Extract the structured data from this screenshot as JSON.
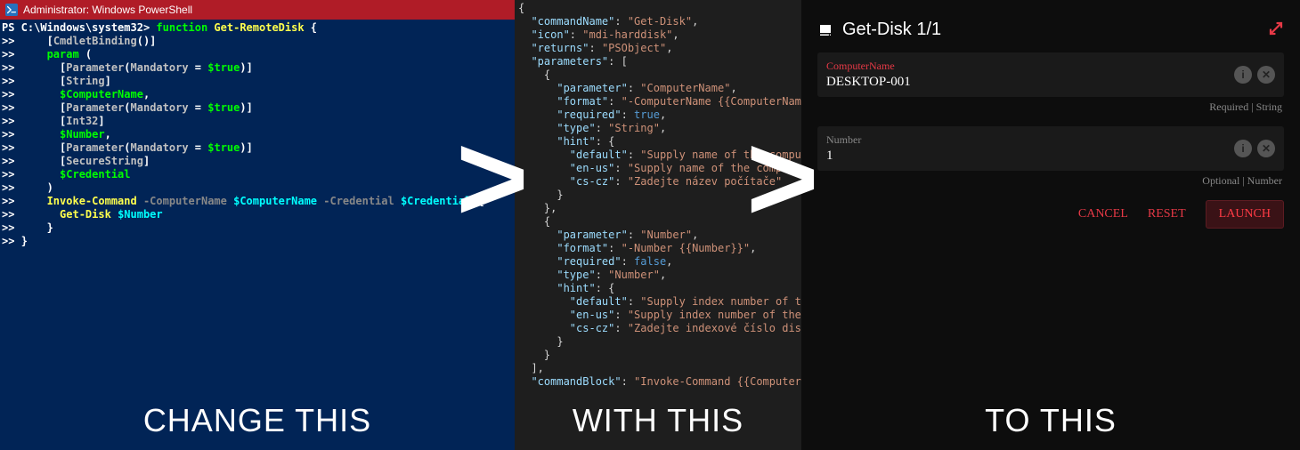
{
  "arrows": {
    "a1": ">",
    "a2": ">"
  },
  "captions": {
    "ps": "CHANGE THIS",
    "json": "WITH THIS",
    "ui": "TO THIS"
  },
  "ps": {
    "title": "Administrator: Windows PowerShell",
    "code": [
      {
        "segs": [
          {
            "t": "PS C:\\Windows\\system32> ",
            "c": "c-white"
          },
          {
            "t": "function",
            "c": "c-key"
          },
          {
            "t": " ",
            "c": "c-white"
          },
          {
            "t": "Get-RemoteDisk",
            "c": "c-cmd"
          },
          {
            "t": " {",
            "c": "c-white"
          }
        ]
      },
      {
        "segs": [
          {
            "t": ">>     ",
            "c": "c-white"
          },
          {
            "t": "[",
            "c": "c-white"
          },
          {
            "t": "CmdletBinding",
            "c": "c-type"
          },
          {
            "t": "()]",
            "c": "c-white"
          }
        ]
      },
      {
        "segs": [
          {
            "t": ">>     ",
            "c": "c-white"
          },
          {
            "t": "param",
            "c": "c-key"
          },
          {
            "t": " (",
            "c": "c-white"
          }
        ]
      },
      {
        "segs": [
          {
            "t": ">>       ",
            "c": "c-white"
          },
          {
            "t": "[",
            "c": "c-white"
          },
          {
            "t": "Parameter",
            "c": "c-type"
          },
          {
            "t": "(",
            "c": "c-white"
          },
          {
            "t": "Mandatory",
            "c": "c-type"
          },
          {
            "t": " = ",
            "c": "c-white"
          },
          {
            "t": "$true",
            "c": "c-key"
          },
          {
            "t": ")]",
            "c": "c-white"
          }
        ]
      },
      {
        "segs": [
          {
            "t": ">>       ",
            "c": "c-white"
          },
          {
            "t": "[",
            "c": "c-white"
          },
          {
            "t": "String",
            "c": "c-type"
          },
          {
            "t": "]",
            "c": "c-white"
          }
        ]
      },
      {
        "segs": [
          {
            "t": ">>       ",
            "c": "c-white"
          },
          {
            "t": "$ComputerName",
            "c": "c-key"
          },
          {
            "t": ",",
            "c": "c-white"
          }
        ]
      },
      {
        "segs": [
          {
            "t": ">>       ",
            "c": "c-white"
          },
          {
            "t": "[",
            "c": "c-white"
          },
          {
            "t": "Parameter",
            "c": "c-type"
          },
          {
            "t": "(",
            "c": "c-white"
          },
          {
            "t": "Mandatory",
            "c": "c-type"
          },
          {
            "t": " = ",
            "c": "c-white"
          },
          {
            "t": "$true",
            "c": "c-key"
          },
          {
            "t": ")]",
            "c": "c-white"
          }
        ]
      },
      {
        "segs": [
          {
            "t": ">>       ",
            "c": "c-white"
          },
          {
            "t": "[",
            "c": "c-white"
          },
          {
            "t": "Int32",
            "c": "c-type"
          },
          {
            "t": "]",
            "c": "c-white"
          }
        ]
      },
      {
        "segs": [
          {
            "t": ">>       ",
            "c": "c-white"
          },
          {
            "t": "$Number",
            "c": "c-key"
          },
          {
            "t": ",",
            "c": "c-white"
          }
        ]
      },
      {
        "segs": [
          {
            "t": ">>       ",
            "c": "c-white"
          },
          {
            "t": "[",
            "c": "c-white"
          },
          {
            "t": "Parameter",
            "c": "c-type"
          },
          {
            "t": "(",
            "c": "c-white"
          },
          {
            "t": "Mandatory",
            "c": "c-type"
          },
          {
            "t": " = ",
            "c": "c-white"
          },
          {
            "t": "$true",
            "c": "c-key"
          },
          {
            "t": ")]",
            "c": "c-white"
          }
        ]
      },
      {
        "segs": [
          {
            "t": ">>       ",
            "c": "c-white"
          },
          {
            "t": "[",
            "c": "c-white"
          },
          {
            "t": "SecureString",
            "c": "c-type"
          },
          {
            "t": "]",
            "c": "c-white"
          }
        ]
      },
      {
        "segs": [
          {
            "t": ">>       ",
            "c": "c-white"
          },
          {
            "t": "$Credential",
            "c": "c-key"
          }
        ]
      },
      {
        "segs": [
          {
            "t": ">>     ",
            "c": "c-white"
          },
          {
            "t": ")",
            "c": "c-white"
          }
        ]
      },
      {
        "segs": [
          {
            "t": ">>     ",
            "c": "c-white"
          },
          {
            "t": "Invoke-Command",
            "c": "c-cmd"
          },
          {
            "t": " -ComputerName ",
            "c": "c-grey"
          },
          {
            "t": "$ComputerName",
            "c": "c-str"
          },
          {
            "t": " -Credential ",
            "c": "c-grey"
          },
          {
            "t": "$Credential",
            "c": "c-str"
          },
          {
            "t": " {",
            "c": "c-white"
          }
        ]
      },
      {
        "segs": [
          {
            "t": ">>       ",
            "c": "c-white"
          },
          {
            "t": "Get-Disk",
            "c": "c-cmd"
          },
          {
            "t": " ",
            "c": "c-white"
          },
          {
            "t": "$Number",
            "c": "c-str"
          }
        ]
      },
      {
        "segs": [
          {
            "t": ">>     ",
            "c": "c-white"
          },
          {
            "t": "}",
            "c": "c-white"
          }
        ]
      },
      {
        "segs": [
          {
            "t": ">> ",
            "c": "c-white"
          },
          {
            "t": "}",
            "c": "c-white"
          }
        ]
      }
    ]
  },
  "json": {
    "lines": [
      [
        {
          "t": "{",
          "c": "jp"
        }
      ],
      [
        {
          "t": "  \"commandName\"",
          "c": "jk"
        },
        {
          "t": ": ",
          "c": "jp"
        },
        {
          "t": "\"Get-Disk\"",
          "c": "js"
        },
        {
          "t": ",",
          "c": "jp"
        }
      ],
      [
        {
          "t": "  \"icon\"",
          "c": "jk"
        },
        {
          "t": ": ",
          "c": "jp"
        },
        {
          "t": "\"mdi-harddisk\"",
          "c": "js"
        },
        {
          "t": ",",
          "c": "jp"
        }
      ],
      [
        {
          "t": "  \"returns\"",
          "c": "jk"
        },
        {
          "t": ": ",
          "c": "jp"
        },
        {
          "t": "\"PSObject\"",
          "c": "js"
        },
        {
          "t": ",",
          "c": "jp"
        }
      ],
      [
        {
          "t": "  \"parameters\"",
          "c": "jk"
        },
        {
          "t": ": [",
          "c": "jp"
        }
      ],
      [
        {
          "t": "    {",
          "c": "jp"
        }
      ],
      [
        {
          "t": "      \"parameter\"",
          "c": "jk"
        },
        {
          "t": ": ",
          "c": "jp"
        },
        {
          "t": "\"ComputerName\"",
          "c": "js"
        },
        {
          "t": ",",
          "c": "jp"
        }
      ],
      [
        {
          "t": "      \"format\"",
          "c": "jk"
        },
        {
          "t": ": ",
          "c": "jp"
        },
        {
          "t": "\"-ComputerName {{ComputerName}}\"",
          "c": "js"
        },
        {
          "t": ",",
          "c": "jp"
        }
      ],
      [
        {
          "t": "      \"required\"",
          "c": "jk"
        },
        {
          "t": ": ",
          "c": "jp"
        },
        {
          "t": "true",
          "c": "jb"
        },
        {
          "t": ",",
          "c": "jp"
        }
      ],
      [
        {
          "t": "      \"type\"",
          "c": "jk"
        },
        {
          "t": ": ",
          "c": "jp"
        },
        {
          "t": "\"String\"",
          "c": "js"
        },
        {
          "t": ",",
          "c": "jp"
        }
      ],
      [
        {
          "t": "      \"hint\"",
          "c": "jk"
        },
        {
          "t": ": {",
          "c": "jp"
        }
      ],
      [
        {
          "t": "        \"default\"",
          "c": "jk"
        },
        {
          "t": ": ",
          "c": "jp"
        },
        {
          "t": "\"Supply name of the computer\"",
          "c": "js"
        },
        {
          "t": ",",
          "c": "jp"
        }
      ],
      [
        {
          "t": "        \"en-us\"",
          "c": "jk"
        },
        {
          "t": ": ",
          "c": "jp"
        },
        {
          "t": "\"Supply name of the computer\"",
          "c": "js"
        },
        {
          "t": ",",
          "c": "jp"
        }
      ],
      [
        {
          "t": "        \"cs-cz\"",
          "c": "jk"
        },
        {
          "t": ": ",
          "c": "jp"
        },
        {
          "t": "\"Zadejte název počítače\"",
          "c": "js"
        }
      ],
      [
        {
          "t": "      }",
          "c": "jp"
        }
      ],
      [
        {
          "t": "    },",
          "c": "jp"
        }
      ],
      [
        {
          "t": "    {",
          "c": "jp"
        }
      ],
      [
        {
          "t": "      \"parameter\"",
          "c": "jk"
        },
        {
          "t": ": ",
          "c": "jp"
        },
        {
          "t": "\"Number\"",
          "c": "js"
        },
        {
          "t": ",",
          "c": "jp"
        }
      ],
      [
        {
          "t": "      \"format\"",
          "c": "jk"
        },
        {
          "t": ": ",
          "c": "jp"
        },
        {
          "t": "\"-Number {{Number}}\"",
          "c": "js"
        },
        {
          "t": ",",
          "c": "jp"
        }
      ],
      [
        {
          "t": "      \"required\"",
          "c": "jk"
        },
        {
          "t": ": ",
          "c": "jp"
        },
        {
          "t": "false",
          "c": "jb"
        },
        {
          "t": ",",
          "c": "jp"
        }
      ],
      [
        {
          "t": "      \"type\"",
          "c": "jk"
        },
        {
          "t": ": ",
          "c": "jp"
        },
        {
          "t": "\"Number\"",
          "c": "js"
        },
        {
          "t": ",",
          "c": "jp"
        }
      ],
      [
        {
          "t": "      \"hint\"",
          "c": "jk"
        },
        {
          "t": ": {",
          "c": "jp"
        }
      ],
      [
        {
          "t": "        \"default\"",
          "c": "jk"
        },
        {
          "t": ": ",
          "c": "jp"
        },
        {
          "t": "\"Supply index number of the disk\"",
          "c": "js"
        },
        {
          "t": ",",
          "c": "jp"
        }
      ],
      [
        {
          "t": "        \"en-us\"",
          "c": "jk"
        },
        {
          "t": ": ",
          "c": "jp"
        },
        {
          "t": "\"Supply index number of the disk\"",
          "c": "js"
        },
        {
          "t": ",",
          "c": "jp"
        }
      ],
      [
        {
          "t": "        \"cs-cz\"",
          "c": "jk"
        },
        {
          "t": ": ",
          "c": "jp"
        },
        {
          "t": "\"Zadejte indexové číslo disku\"",
          "c": "js"
        }
      ],
      [
        {
          "t": "      }",
          "c": "jp"
        }
      ],
      [
        {
          "t": "    }",
          "c": "jp"
        }
      ],
      [
        {
          "t": "  ],",
          "c": "jp"
        }
      ],
      [
        {
          "t": "  \"commandBlock\"",
          "c": "jk"
        },
        {
          "t": ": ",
          "c": "jp"
        },
        {
          "t": "\"Invoke-Command {{ComputerName}} -Cr",
          "c": "js"
        }
      ]
    ]
  },
  "form": {
    "title": "Get-Disk 1/1",
    "fields": [
      {
        "label": "ComputerName",
        "value": "DESKTOP-001",
        "meta": "Required | String",
        "labelcls": "lbl"
      },
      {
        "label": "Number",
        "value": "1",
        "meta": "Optional | Number",
        "labelcls": "lbl grey"
      }
    ],
    "info_glyph": "i",
    "clear_glyph": "✕",
    "actions": {
      "cancel": "CANCEL",
      "reset": "RESET",
      "launch": "LAUNCH"
    }
  }
}
